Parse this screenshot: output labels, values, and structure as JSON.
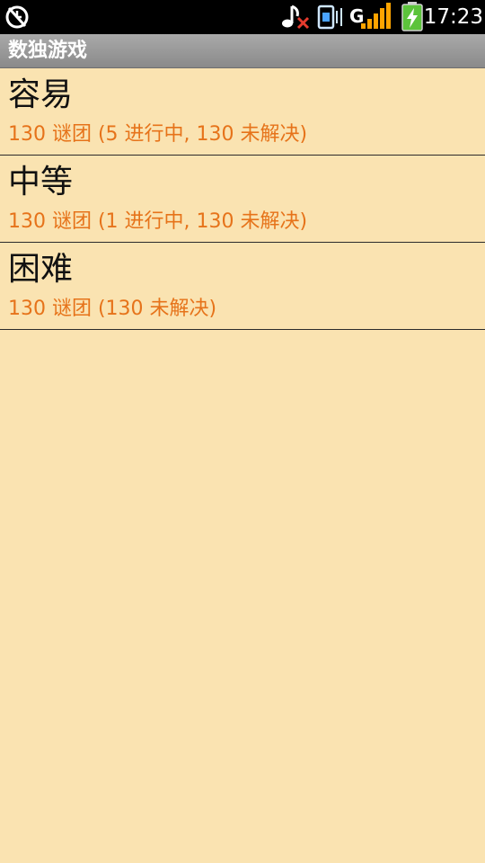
{
  "status_bar": {
    "time": "17:23",
    "icons": [
      "alarm-off-icon",
      "music-muted-icon",
      "sim-card-icon",
      "signal-strength-icon",
      "battery-charging-icon"
    ],
    "signal_label": "G"
  },
  "app": {
    "title": "数独游戏"
  },
  "levels": [
    {
      "title": "容易",
      "subtitle": "130 谜团 (5 进行中, 130 未解决)"
    },
    {
      "title": "中等",
      "subtitle": "130 谜团 (1 进行中, 130 未解决)"
    },
    {
      "title": "困难",
      "subtitle": "130 谜团 (130 未解决)"
    }
  ],
  "colors": {
    "background": "#fae3b1",
    "subtitle": "#e6731a",
    "title_bar": "#9a9a9a",
    "battery_green": "#5cc33b",
    "signal_orange": "#ffa400"
  }
}
